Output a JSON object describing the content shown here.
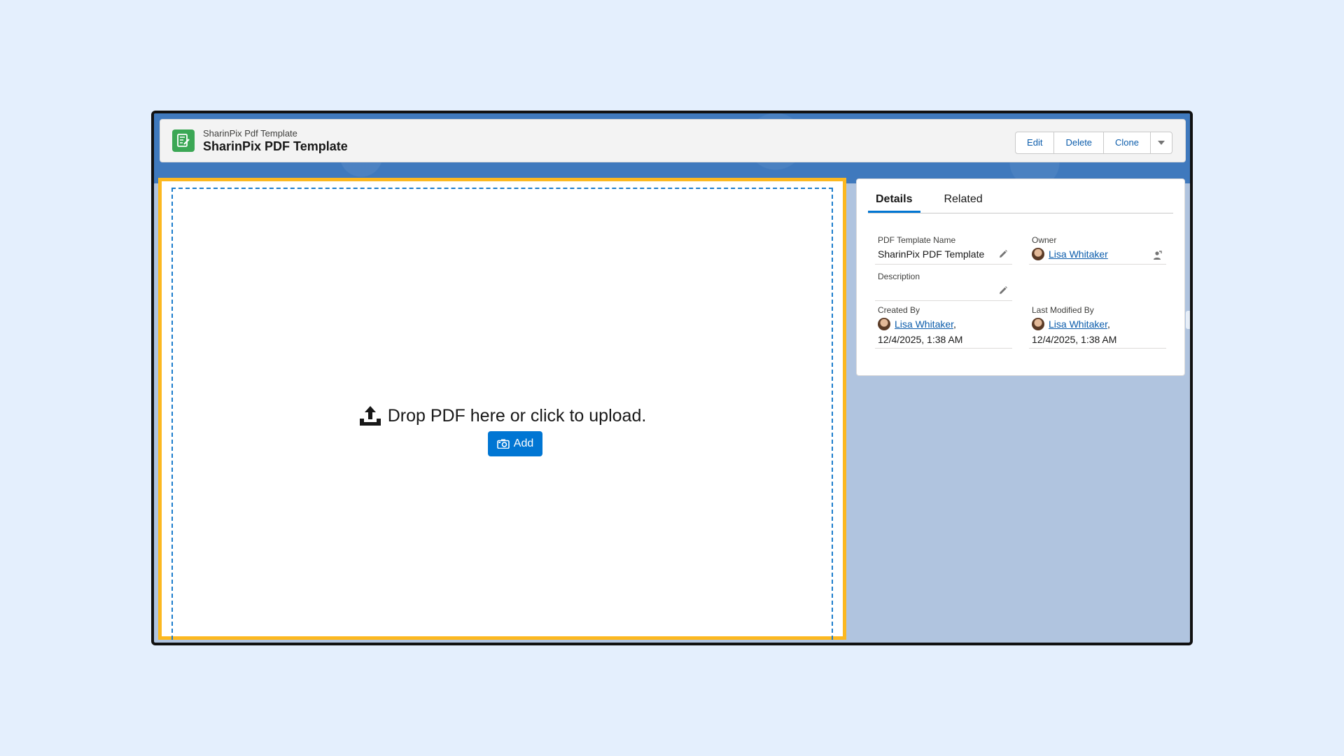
{
  "header": {
    "object_label": "SharinPix Pdf Template",
    "record_title": "SharinPix PDF Template",
    "actions": {
      "edit": "Edit",
      "delete": "Delete",
      "clone": "Clone"
    }
  },
  "upload": {
    "message": "Drop PDF here or click to upload.",
    "add_label": "Add"
  },
  "details": {
    "tabs": [
      "Details",
      "Related"
    ],
    "fields": {
      "name_label": "PDF Template Name",
      "name_value": "SharinPix PDF Template",
      "owner_label": "Owner",
      "owner_value": "Lisa Whitaker",
      "description_label": "Description",
      "created_label": "Created By",
      "created_user": "Lisa Whitaker",
      "created_date": "12/4/2025, 1:38 AM",
      "modified_label": "Last Modified By",
      "modified_user": "Lisa Whitaker",
      "modified_date": "12/4/2025, 1:38 AM"
    }
  },
  "colors": {
    "brand_blue": "#0176d3",
    "highlight_yellow": "#fcb820",
    "object_green": "#3ba755"
  }
}
